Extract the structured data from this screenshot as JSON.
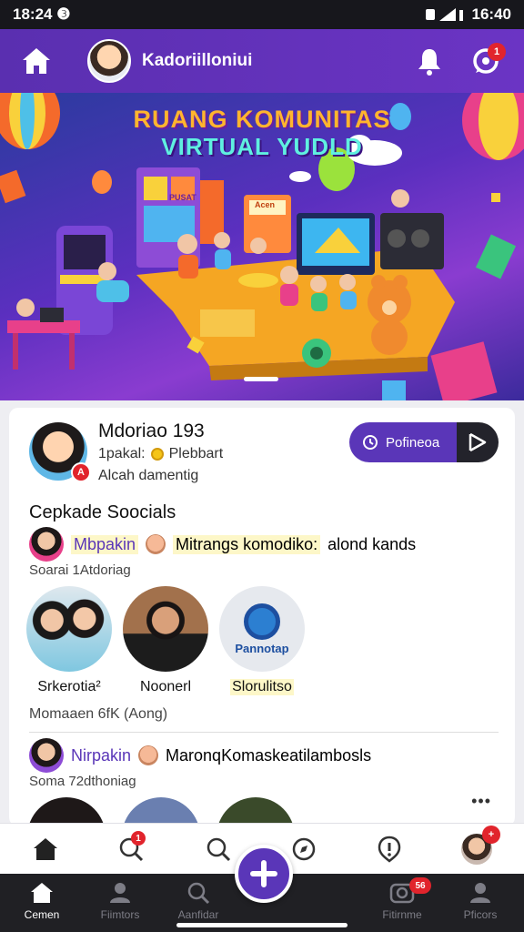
{
  "status_bar": {
    "time": "18:24 ❸",
    "clock_right": "16:40"
  },
  "app_bar": {
    "title": "Kadoriilloniui",
    "notification_count": "1"
  },
  "banner": {
    "headline_line1": "RUANG KOMUNITAS",
    "headline_line2": "VIRTUAL YUDLD",
    "arcade_sign": "PUSAT",
    "stage_sign": "Acen"
  },
  "profile": {
    "name": "Mdoriao 193",
    "stats_prefix": "1pakal:",
    "stats_value": "Plebbart",
    "subtitle": "Alcah damentig",
    "avatar_badge": "A",
    "action_label": "Pofineoa"
  },
  "social": {
    "section_title": "Cepkade Soocials",
    "activity1": {
      "user": "Mbpakin",
      "target": "Mitrangs komodiko:",
      "rest": "alond kands",
      "sub": "Soarai  1Atdoriag"
    },
    "circles": [
      {
        "caption": "Srkerotia²"
      },
      {
        "caption": "Noonerl"
      },
      {
        "caption": "Slorulitso",
        "logo_text": "Pannotap"
      }
    ],
    "meta": "Momaaen 6fK (Aong)",
    "activity2": {
      "user": "Nirpakin",
      "rest": "MaronqKomaskeatilambosls",
      "sub": "Soma  72dthoniag"
    },
    "more_label": "•••"
  },
  "tabbar_top": {
    "search_badge": "1",
    "profile_badge": "+"
  },
  "bottom_nav": {
    "items": [
      {
        "label": "Cemen"
      },
      {
        "label": "Fiimtors"
      },
      {
        "label": "Aanfidar"
      },
      {
        "label": "Fitirnme"
      },
      {
        "label": "Pficors"
      }
    ],
    "badge": "56"
  },
  "colors": {
    "accent": "#5a36b8",
    "appbar": "#6b34c4",
    "badge": "#e1242c",
    "highlight": "#fdf7c8"
  }
}
